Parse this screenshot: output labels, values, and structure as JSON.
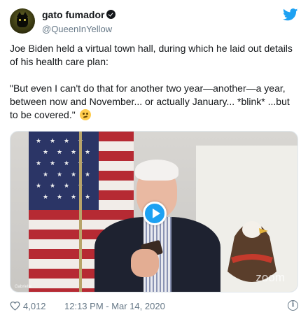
{
  "tweet": {
    "author": {
      "display_name": "gato fumador",
      "handle": "@QueenInYellow",
      "avatar_icon": "black-cat-avatar",
      "verified_icon": "verified-badge-icon"
    },
    "brand_icon": "twitter-bird-icon",
    "text": {
      "paragraph1": "Joe Biden held a virtual town hall, during which he laid out details of his health care plan:",
      "paragraph2": "\"But even I can't do that for another two year—another—a year, between now and November... or actually January... *blink* ...but to be covered.\"",
      "emoji": "woozy-face-emoji"
    },
    "media": {
      "play_icon": "play-icon",
      "watermark": "zoom",
      "source_label": "Gabrielle"
    },
    "footer": {
      "likes": "4,012",
      "timestamp": "12:13 PM - Mar 14, 2020",
      "heart_icon": "heart-icon",
      "info_icon": "info-icon",
      "info_glyph": "i"
    }
  },
  "colors": {
    "accent": "#1da1f2",
    "text_primary": "#14171a",
    "text_secondary": "#657786"
  }
}
